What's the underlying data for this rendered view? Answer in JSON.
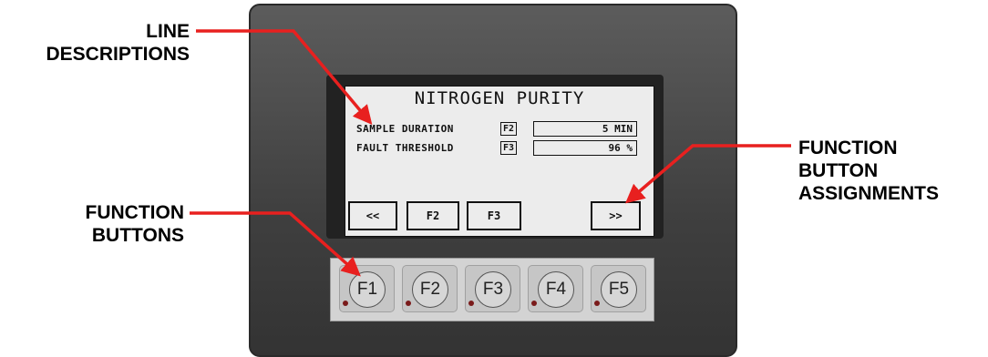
{
  "callouts": {
    "line_descriptions": [
      "LINE",
      "DESCRIPTIONS"
    ],
    "function_buttons": [
      "FUNCTION",
      "BUTTONS"
    ],
    "function_button_assignments": [
      "FUNCTION",
      "BUTTON",
      "ASSIGNMENTS"
    ]
  },
  "screen": {
    "title": "NITROGEN PURITY",
    "rows": [
      {
        "description": "SAMPLE DURATION",
        "key": "F2",
        "value": "5 MIN"
      },
      {
        "description": "FAULT THRESHOLD",
        "key": "F3",
        "value": "96 %"
      }
    ],
    "softkeys": [
      "<<",
      "F2",
      "F3",
      ">>"
    ]
  },
  "keypad": {
    "buttons": [
      "F1",
      "F2",
      "F3",
      "F4",
      "F5"
    ]
  },
  "colors": {
    "arrow": "#e8201f",
    "led": "#7a1b1b"
  }
}
